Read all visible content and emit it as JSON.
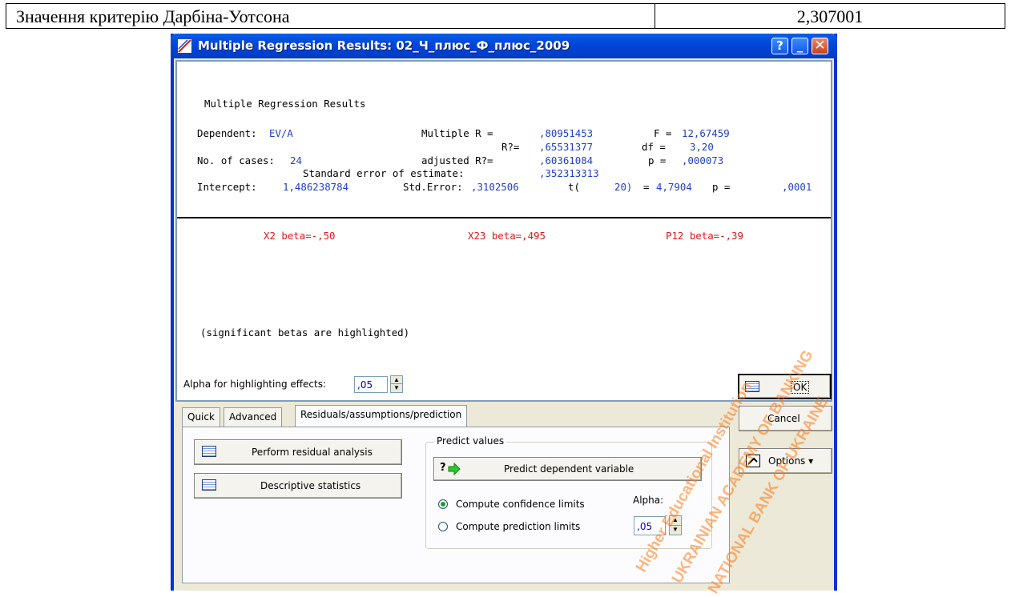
{
  "document": {
    "label": "Значення критерію Дарбіна-Уотсона",
    "value": "2,307001"
  },
  "window": {
    "title": "Multiple Regression Results: 02_Ч_плюс_Ф_плюс_2009",
    "help": "?",
    "minimize": "_",
    "close": "✕"
  },
  "results": {
    "heading": "Multiple Regression Results",
    "dependent_label": "Dependent:",
    "dependent_value": "EV/A",
    "multiple_r_label": "Multiple R =",
    "multiple_r_value": ",80951453",
    "f_label": "F =",
    "f_value": "12,67459",
    "r2_label": "R?=",
    "r2_value": ",65531377",
    "df_label": "df =",
    "df_value": "3,20",
    "cases_label": "No. of cases:",
    "cases_value": "24",
    "adj_r2_label": "adjusted R?=",
    "adj_r2_value": ",60361084",
    "p_label": "p =",
    "p_value": ",000073",
    "se_label": "Standard error of estimate:",
    "se_value": ",352313313",
    "intercept_label": "Intercept:",
    "intercept_value": "1,486238784",
    "std_error_label": "Std.Error:",
    "std_error_value": ",3102506",
    "t_label": "t(",
    "t_df": "20)",
    "t_eq": "=",
    "t_value": "4,7904",
    "p2_label": "p =",
    "p2_value": ",0001",
    "betas": [
      "X2 beta=-,50",
      "X23 beta=,495",
      "P12 beta=-,39"
    ],
    "note": "(significant betas are highlighted)",
    "copy_icon": "⎘",
    "expand_icon": "±"
  },
  "controls": {
    "alpha_label": "Alpha for highlighting effects:",
    "alpha_value": ",05",
    "ok": "OK",
    "cancel": "Cancel",
    "options": "Options ▾",
    "tabs": [
      "Quick",
      "Advanced",
      "Residuals/assumptions/prediction"
    ],
    "perform_residual": "Perform residual analysis",
    "descriptive": "Descriptive statistics",
    "predict_group": "Predict values",
    "predict_button": "Predict dependent variable",
    "confidence": "Compute confidence limits",
    "prediction": "Compute prediction limits",
    "alpha2_label": "Alpha:",
    "alpha2_value": ",05"
  },
  "watermark": [
    "Higher Educational Institution",
    "UKRAINIAN ACADEMY OF BANKING",
    "NATIONAL BANK OF UKRAINE"
  ]
}
